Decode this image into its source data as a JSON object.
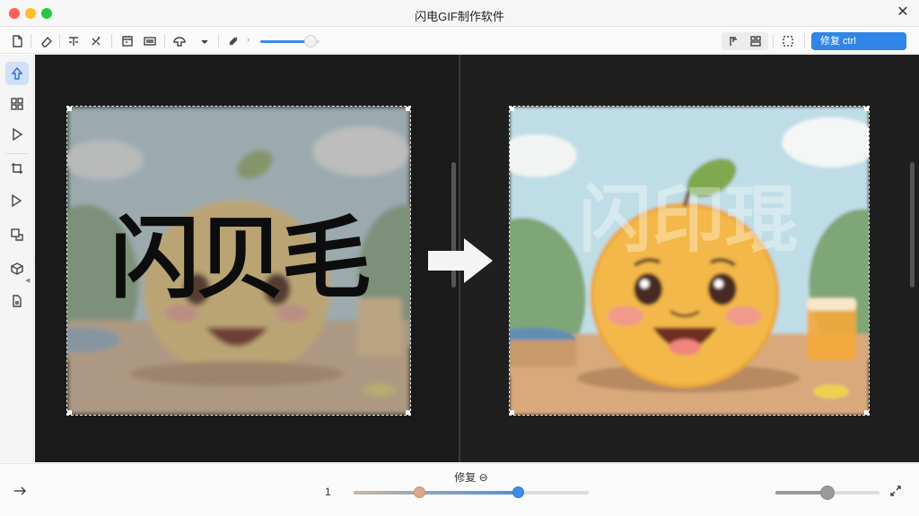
{
  "window": {
    "title": "闪电GIF制作软件",
    "close_glyph": "✕"
  },
  "toolbar": {
    "icons": [
      "file-icon",
      "eraser-icon",
      "text-icon",
      "magic-icon",
      "calendar-icon",
      "layers-icon",
      "palette-icon",
      "dropdown-icon",
      "brush-icon"
    ],
    "slider_value": 0.85,
    "repair_button_label": "修复 ctrl"
  },
  "sidebar": {
    "icons": [
      "pointer-icon",
      "grid-icon",
      "play-icon",
      "crop-icon",
      "flip-icon",
      "resize-icon",
      "cube-icon",
      "export-icon"
    ],
    "active_index": 0
  },
  "canvas": {
    "left_watermark_text": "闪贝毛",
    "right_watermark_text": "闪印琨",
    "colors": {
      "accent": "#2f86e6",
      "canvas_bg": "#1c1c1c",
      "sky": "#bfdde6",
      "table": "#d7a87a",
      "orange": "#f3b84a"
    }
  },
  "bottombar": {
    "caption": "修复 ⊖",
    "frame_number": "1",
    "range_start": 0.28,
    "range_end": 0.7,
    "zoom_level": 0.5
  }
}
